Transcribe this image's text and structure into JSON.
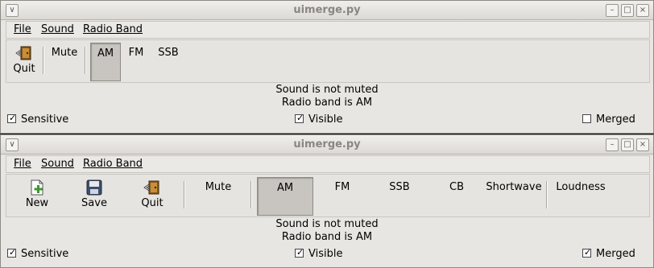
{
  "windows": [
    {
      "title": "uimerge.py",
      "menus": [
        "File",
        "Sound",
        "Radio Band"
      ],
      "tools": [
        {
          "label": "Quit",
          "icon": "quit-icon"
        }
      ],
      "mute_label": "Mute",
      "bands": [
        "AM",
        "FM",
        "SSB"
      ],
      "active_band": "AM",
      "status_sound": "Sound is not muted",
      "status_band": "Radio band is AM",
      "checks": {
        "sensitive": {
          "label": "Sensitive",
          "checked": true
        },
        "visible": {
          "label": "Visible",
          "checked": true
        },
        "merged": {
          "label": "Merged",
          "checked": false
        }
      }
    },
    {
      "title": "uimerge.py",
      "menus": [
        "File",
        "Sound",
        "Radio Band"
      ],
      "tools": [
        {
          "label": "New",
          "icon": "new-icon"
        },
        {
          "label": "Save",
          "icon": "save-icon"
        },
        {
          "label": "Quit",
          "icon": "quit-icon"
        }
      ],
      "mute_label": "Mute",
      "bands": [
        "AM",
        "FM",
        "SSB",
        "CB",
        "Shortwave"
      ],
      "active_band": "AM",
      "loudness_label": "Loudness",
      "status_sound": "Sound is not muted",
      "status_band": "Radio band is AM",
      "checks": {
        "sensitive": {
          "label": "Sensitive",
          "checked": true
        },
        "visible": {
          "label": "Visible",
          "checked": true
        },
        "merged": {
          "label": "Merged",
          "checked": true
        }
      }
    }
  ],
  "titlebar_buttons": {
    "menu": "∨",
    "minimize": "–",
    "maximize": "□",
    "close": "×"
  },
  "check_glyph": "✓"
}
